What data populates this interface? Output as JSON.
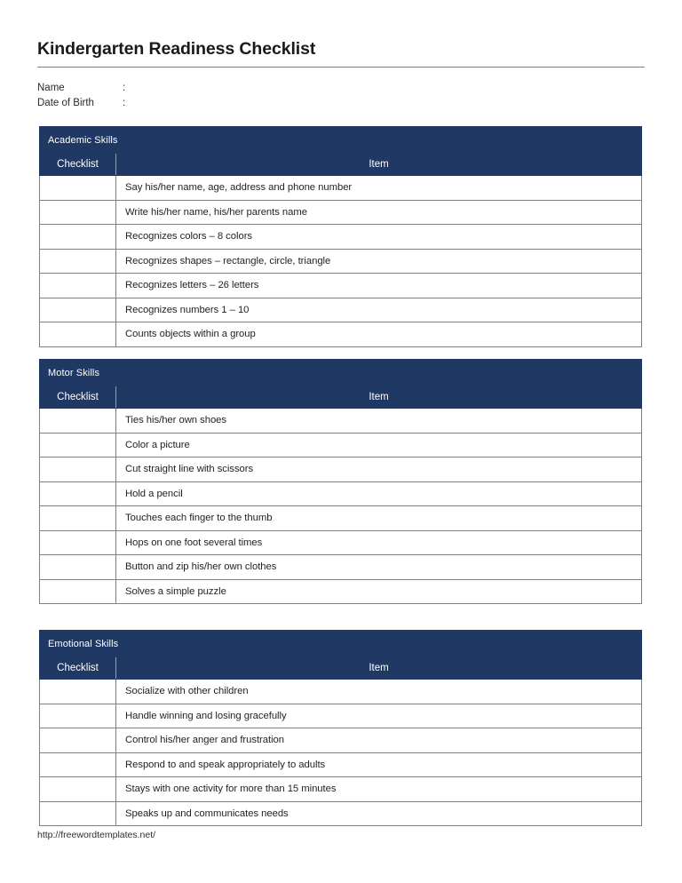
{
  "document": {
    "title": "Kindergarten Readiness Checklist",
    "accent_color": "#1f3864",
    "border_color": "#808080"
  },
  "meta": {
    "name_label": "Name",
    "name_colon": ":",
    "name_value": "",
    "dob_label": "Date of Birth",
    "dob_colon": ":",
    "dob_value": ""
  },
  "columns": {
    "checklist": "Checklist",
    "item": "Item"
  },
  "sections": [
    {
      "title": "Academic Skills",
      "items": [
        "Say his/her name, age, address and phone number",
        "Write his/her name, his/her parents name",
        "Recognizes colors – 8 colors",
        "Recognizes shapes – rectangle, circle, triangle",
        "Recognizes letters – 26 letters",
        "Recognizes numbers 1 – 10",
        "Counts objects within a group"
      ]
    },
    {
      "title": "Motor Skills",
      "items": [
        "Ties his/her own shoes",
        "Color a picture",
        "Cut straight line with scissors",
        "Hold a pencil",
        "Touches each finger to the thumb",
        "Hops on one foot several times",
        "Button and zip his/her own clothes",
        "Solves a simple puzzle"
      ]
    },
    {
      "title": "Emotional Skills",
      "items": [
        "Socialize with other children",
        "Handle winning and losing gracefully",
        "Control his/her anger and frustration",
        "Respond to and speak appropriately to adults",
        "Stays with one activity for more than 15 minutes",
        "Speaks up and communicates needs"
      ]
    }
  ],
  "footer": {
    "url": "http://freewordtemplates.net/"
  }
}
